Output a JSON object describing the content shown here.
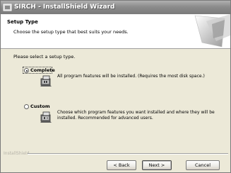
{
  "window": {
    "title": "SIRCH - InstallShield Wizard"
  },
  "header": {
    "title": "Setup Type",
    "subtitle": "Choose the setup type that best suits your needs."
  },
  "prompt": "Please select a setup type.",
  "options": [
    {
      "label": "Complete",
      "selected": true,
      "description": "All program features will be installed. (Requires the most disk space.)",
      "icon": "setup-complete-icon"
    },
    {
      "label": "Custom",
      "selected": false,
      "description": "Choose which program features you want installed and where they will be installed. Recommended for advanced users.",
      "icon": "setup-custom-icon"
    }
  ],
  "brand": "InstallShield",
  "buttons": {
    "back": "< Back",
    "next": "Next >",
    "cancel": "Cancel"
  }
}
